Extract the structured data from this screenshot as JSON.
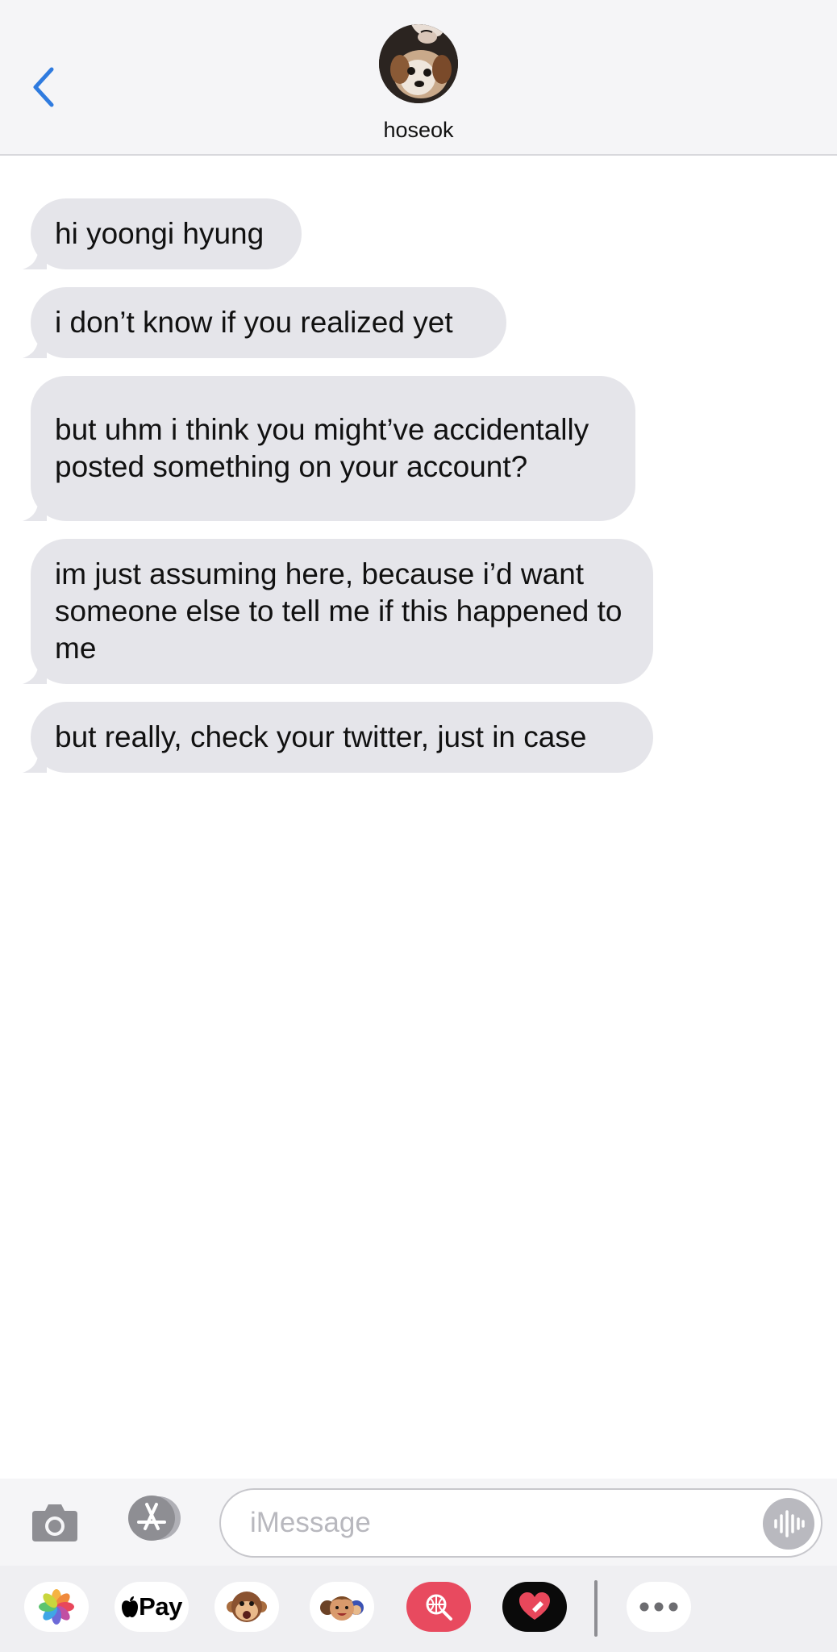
{
  "header": {
    "contact_name": "hoseok",
    "back_icon": "chevron-left-icon",
    "accent_color": "#2f7bdf"
  },
  "messages": [
    {
      "sender": "hoseok",
      "text": "hi yoongi hyung"
    },
    {
      "sender": "hoseok",
      "text": "i don’t know if you realized yet"
    },
    {
      "sender": "hoseok",
      "text": "but uhm i think you might’ve accidentally posted something on your account?"
    },
    {
      "sender": "hoseok",
      "text": "im just assuming here, because i’d want someone else to tell me if this happened to me"
    },
    {
      "sender": "hoseok",
      "text": "but really, check your twitter, just in case"
    }
  ],
  "compose": {
    "placeholder": "iMessage",
    "camera_icon": "camera-icon",
    "appstore_icon": "app-store-icon",
    "audio_icon": "audio-waveform-icon"
  },
  "drawer": {
    "apps": [
      {
        "name": "photos",
        "icon": "photos-icon"
      },
      {
        "name": "apple-pay",
        "label": "Pay",
        "icon": "apple-pay-icon"
      },
      {
        "name": "animoji",
        "icon": "monkey-animoji-icon"
      },
      {
        "name": "memoji",
        "icon": "memoji-stickers-icon"
      },
      {
        "name": "web-search",
        "icon": "globe-search-icon"
      },
      {
        "name": "digital-touch",
        "icon": "heart-touch-icon"
      },
      {
        "name": "more",
        "icon": "more-ellipsis-icon"
      }
    ]
  },
  "colors": {
    "bubble_received": "#e5e5ea",
    "header_bg": "#f5f5f7"
  }
}
